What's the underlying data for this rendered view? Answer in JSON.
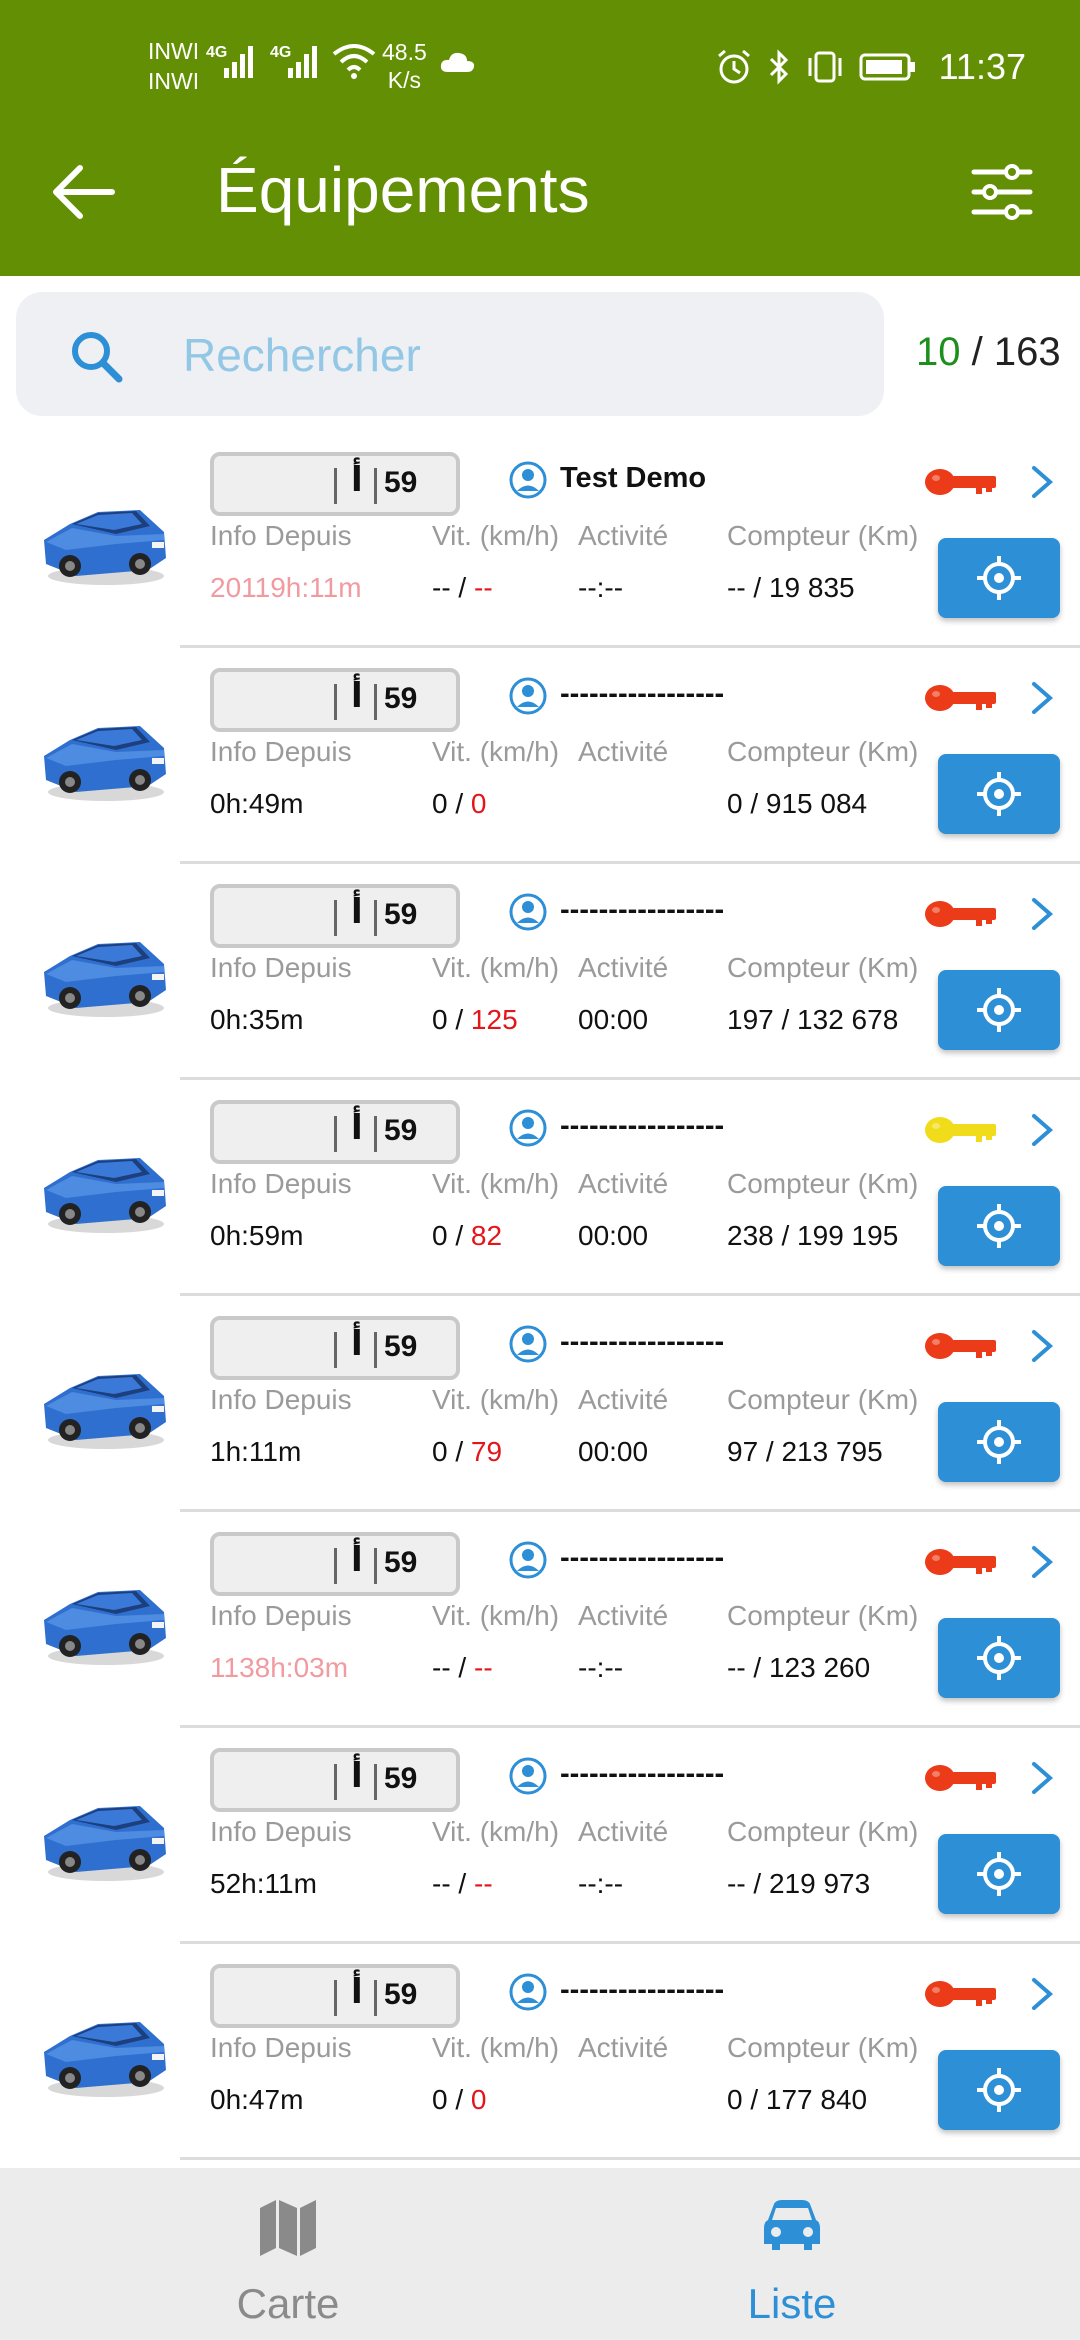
{
  "status_bar": {
    "carrier_1": "INWI",
    "carrier_2": "INWI",
    "network_1": "4G",
    "network_2": "4G",
    "speed_value": "48.5",
    "speed_unit": "K/s",
    "time": "11:37"
  },
  "header": {
    "title": "Équipements"
  },
  "search": {
    "placeholder": "Rechercher",
    "value": ""
  },
  "counter": {
    "shown": "10",
    "separator": " / ",
    "total": "163"
  },
  "labels": {
    "info": "Info Depuis",
    "speed": "Vit. (km/h)",
    "activity": "Activité",
    "odometer": "Compteur (Km)"
  },
  "colors": {
    "header": "#638f04",
    "accent_blue": "#2d8fd6",
    "key_red": "#ec3b18",
    "key_yellow": "#f0dc1a",
    "alert_red": "#e3161c"
  },
  "rows": [
    {
      "plate_letter": "أ",
      "plate_number": "59",
      "driver": "Test Demo",
      "key_color": "red",
      "info": "20119h:11m",
      "info_alert": true,
      "speed_a": "-- / ",
      "speed_b": "--",
      "activity": "--:--",
      "odometer": "-- / 19 835"
    },
    {
      "plate_letter": "أ",
      "plate_number": "59",
      "driver": "-----------------",
      "key_color": "red",
      "info": "0h:49m",
      "info_alert": false,
      "speed_a": "0 / ",
      "speed_b": "0",
      "activity": "",
      "odometer": "0 / 915 084"
    },
    {
      "plate_letter": "أ",
      "plate_number": "59",
      "driver": "-----------------",
      "key_color": "red",
      "info": "0h:35m",
      "info_alert": false,
      "speed_a": "0 / ",
      "speed_b": "125",
      "activity": "00:00",
      "odometer": "197 / 132 678"
    },
    {
      "plate_letter": "أ",
      "plate_number": "59",
      "driver": "-----------------",
      "key_color": "yellow",
      "info": "0h:59m",
      "info_alert": false,
      "speed_a": "0 / ",
      "speed_b": "82",
      "activity": "00:00",
      "odometer": "238 / 199 195"
    },
    {
      "plate_letter": "أ",
      "plate_number": "59",
      "driver": "-----------------",
      "key_color": "red",
      "info": "1h:11m",
      "info_alert": false,
      "speed_a": "0 / ",
      "speed_b": "79",
      "activity": "00:00",
      "odometer": "97 / 213 795"
    },
    {
      "plate_letter": "أ",
      "plate_number": "59",
      "driver": "-----------------",
      "key_color": "red",
      "info": "1138h:03m",
      "info_alert": true,
      "speed_a": "-- / ",
      "speed_b": "--",
      "activity": "--:--",
      "odometer": "-- / 123 260"
    },
    {
      "plate_letter": "أ",
      "plate_number": "59",
      "driver": "-----------------",
      "key_color": "red",
      "info": "52h:11m",
      "info_alert": false,
      "speed_a": "-- / ",
      "speed_b": "--",
      "activity": "--:--",
      "odometer": "-- / 219 973"
    },
    {
      "plate_letter": "أ",
      "plate_number": "59",
      "driver": "-----------------",
      "key_color": "red",
      "info": "0h:47m",
      "info_alert": false,
      "speed_a": "0 / ",
      "speed_b": "0",
      "activity": "",
      "odometer": "0 / 177 840"
    }
  ],
  "bottom_nav": {
    "items": [
      {
        "label": "Carte",
        "icon": "map-icon",
        "active": false
      },
      {
        "label": "Liste",
        "icon": "car-icon",
        "active": true
      }
    ]
  }
}
